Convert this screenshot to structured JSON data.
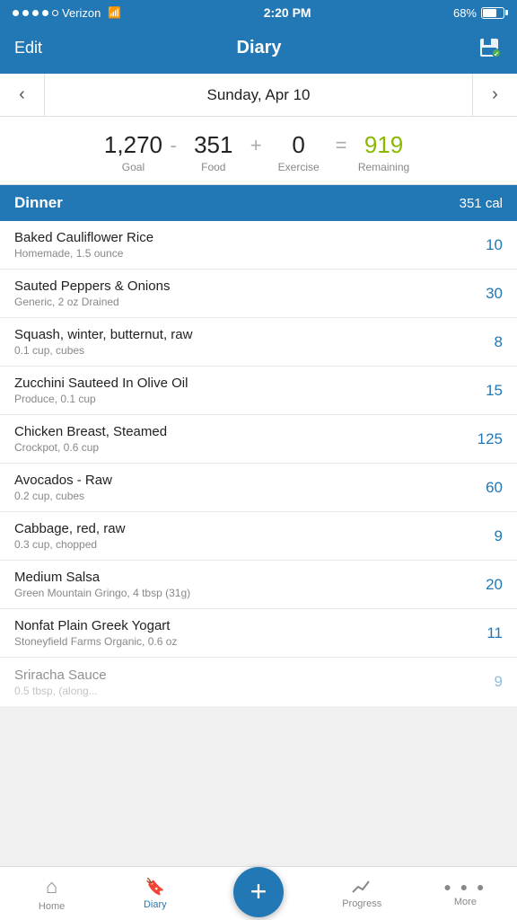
{
  "statusBar": {
    "carrier": "Verizon",
    "time": "2:20 PM",
    "battery": "68%"
  },
  "header": {
    "editLabel": "Edit",
    "title": "Diary",
    "saveIcon": "💾"
  },
  "dateNav": {
    "prevArrow": "‹",
    "nextArrow": "›",
    "date": "Sunday, Apr 10"
  },
  "calorieSummary": {
    "goal": {
      "value": "1,270",
      "label": "Goal"
    },
    "minusOp": "-",
    "food": {
      "value": "351",
      "label": "Food"
    },
    "plusOp": "+",
    "exercise": {
      "value": "0",
      "label": "Exercise"
    },
    "equalsOp": "=",
    "remaining": {
      "value": "919",
      "label": "Remaining"
    }
  },
  "dinnerSection": {
    "title": "Dinner",
    "calories": "351 cal"
  },
  "foodItems": [
    {
      "name": "Baked Cauliflower Rice",
      "detail": "Homemade, 1.5 ounce",
      "cal": "10"
    },
    {
      "name": "Sauted Peppers & Onions",
      "detail": "Generic, 2 oz Drained",
      "cal": "30"
    },
    {
      "name": "Squash, winter, butternut, raw",
      "detail": "0.1 cup, cubes",
      "cal": "8"
    },
    {
      "name": "Zucchini Sauteed In Olive Oil",
      "detail": "Produce, 0.1 cup",
      "cal": "15"
    },
    {
      "name": "Chicken Breast, Steamed",
      "detail": "Crockpot, 0.6 cup",
      "cal": "125"
    },
    {
      "name": "Avocados - Raw",
      "detail": "0.2 cup, cubes",
      "cal": "60"
    },
    {
      "name": "Cabbage, red, raw",
      "detail": "0.3 cup, chopped",
      "cal": "9"
    },
    {
      "name": "Medium Salsa",
      "detail": "Green Mountain Gringo, 4 tbsp  (31g)",
      "cal": "20"
    },
    {
      "name": "Nonfat Plain Greek Yogart",
      "detail": "Stoneyfield Farms Organic, 0.6 oz",
      "cal": "11"
    },
    {
      "name": "Sriracha Sauce",
      "detail": "0.5 tbsp, (along...",
      "cal": "9",
      "fading": true
    }
  ],
  "bottomNav": [
    {
      "id": "home",
      "label": "Home",
      "icon": "⌂",
      "active": false
    },
    {
      "id": "diary",
      "label": "Diary",
      "icon": "🔖",
      "active": true
    },
    {
      "id": "add",
      "label": "",
      "icon": "+",
      "isFab": true
    },
    {
      "id": "progress",
      "label": "Progress",
      "icon": "📈",
      "active": false
    },
    {
      "id": "more",
      "label": "More",
      "icon": "···",
      "active": false
    }
  ],
  "colors": {
    "primary": "#2278b5",
    "remaining": "#8cb800"
  }
}
